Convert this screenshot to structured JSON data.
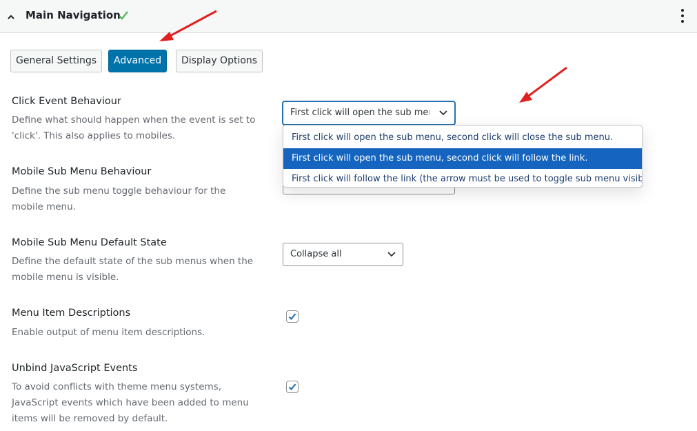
{
  "header": {
    "title": "Main Navigation",
    "collapse_icon": "chevron-up-icon",
    "status_icon": "checkmark-icon",
    "menu_icon": "more-vertical-icon"
  },
  "tabs": [
    {
      "label": "General Settings",
      "active": false
    },
    {
      "label": "Advanced",
      "active": true
    },
    {
      "label": "Display Options",
      "active": false
    }
  ],
  "settings": {
    "click_event": {
      "label": "Click Event Behaviour",
      "description": "Define what should happen when the event is set to 'click'. This also applies to mobiles.",
      "selected": "First click will open the sub menu, second click will follow the link.",
      "options": [
        "First click will open the sub menu, second click will close the sub menu.",
        "First click will open the sub menu, second click will follow the link.",
        "First click will follow the link (the arrow must be used to toggle sub menu visiblity)."
      ]
    },
    "mobile_sub_menu": {
      "label": "Mobile Sub Menu Behaviour",
      "description": "Define the sub menu toggle behaviour for the mobile menu."
    },
    "mobile_default_state": {
      "label": "Mobile Sub Menu Default State",
      "description": "Define the default state of the sub menus when the mobile menu is visible.",
      "selected": "Collapse all"
    },
    "menu_item_descriptions": {
      "label": "Menu Item Descriptions",
      "description": "Enable output of menu item descriptions.",
      "checked": true
    },
    "unbind_js": {
      "label": "Unbind JavaScript Events",
      "description": "To avoid conflicts with theme menu systems, JavaScript events which have been added to menu items will be removed by default.",
      "checked": true
    }
  },
  "colors": {
    "accent": "#0073aa",
    "highlight": "#1565c0",
    "check_green": "#46b450",
    "annotation_red": "#e02020"
  }
}
